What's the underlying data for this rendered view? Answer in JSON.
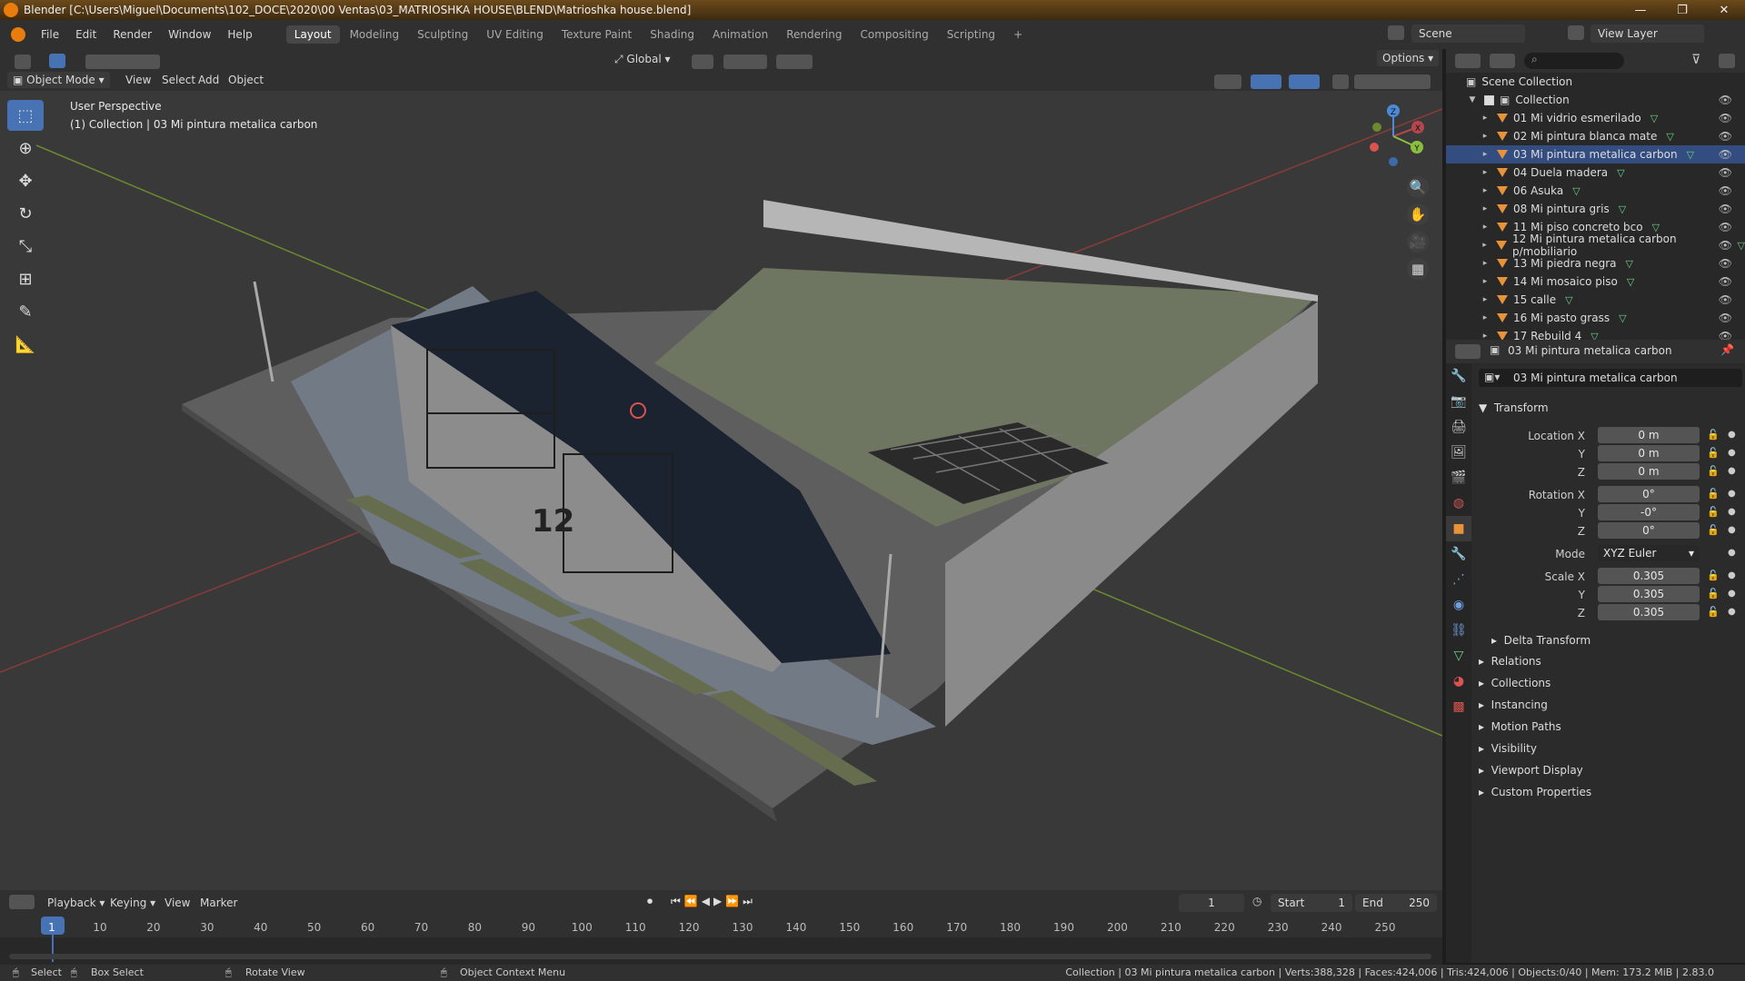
{
  "window": {
    "title": "Blender [C:\\Users\\Miguel\\Documents\\102_DOCE\\2020\\00 Ventas\\03_MATRIOSHKA HOUSE\\BLEND\\Matrioshka house.blend]",
    "controls": [
      "—",
      "❐",
      "✕"
    ]
  },
  "menus": [
    "File",
    "Edit",
    "Render",
    "Window",
    "Help"
  ],
  "workspaces": [
    {
      "label": "Layout",
      "active": true
    },
    {
      "label": "Modeling"
    },
    {
      "label": "Sculpting"
    },
    {
      "label": "UV Editing"
    },
    {
      "label": "Texture Paint"
    },
    {
      "label": "Shading"
    },
    {
      "label": "Animation"
    },
    {
      "label": "Rendering"
    },
    {
      "label": "Compositing"
    },
    {
      "label": "Scripting"
    }
  ],
  "add_workspace": "+",
  "scene": "Scene",
  "view_layer": "View Layer",
  "viewport_header": {
    "mode": "Object Mode",
    "menus": [
      "View",
      "Select",
      "Add",
      "Object"
    ],
    "orientation": "Global",
    "options": "Options"
  },
  "viewport": {
    "perspective": "User Perspective",
    "info": "(1) Collection | 03 Mi pintura metalica carbon",
    "building_number": "12"
  },
  "gizmo": {
    "x": "X",
    "y": "Y",
    "z": "Z"
  },
  "outliner": {
    "root": "Scene Collection",
    "collection": "Collection",
    "items": [
      {
        "label": "01 Mi vidrio esmerilado"
      },
      {
        "label": "02 Mi pintura blanca mate"
      },
      {
        "label": "03 Mi pintura metalica carbon",
        "selected": true
      },
      {
        "label": "04 Duela madera"
      },
      {
        "label": "06 Asuka"
      },
      {
        "label": "08 Mi pintura gris"
      },
      {
        "label": "11 Mi piso concreto bco"
      },
      {
        "label": "12 Mi pintura metalica carbon p/mobiliario"
      },
      {
        "label": "13 Mi piedra negra"
      },
      {
        "label": "14 Mi mosaico piso"
      },
      {
        "label": "15 calle"
      },
      {
        "label": "16 Mi pasto grass"
      },
      {
        "label": "17 Rebuild 4"
      }
    ]
  },
  "properties": {
    "object_name": "03 Mi pintura metalica carbon",
    "datablock": "03 Mi pintura metalica carbon",
    "transform_label": "Transform",
    "location_label": "Location X",
    "rotation_label": "Rotation X",
    "scale_label": "Scale X",
    "y_label": "Y",
    "z_label": "Z",
    "location": [
      "0 m",
      "0 m",
      "0 m"
    ],
    "rotation": [
      "0°",
      "-0°",
      "0°"
    ],
    "mode_label": "Mode",
    "mode": "XYZ Euler",
    "scale": [
      "0.305",
      "0.305",
      "0.305"
    ],
    "delta": "Delta Transform",
    "panels": [
      "Relations",
      "Collections",
      "Instancing",
      "Motion Paths",
      "Visibility",
      "Viewport Display",
      "Custom Properties"
    ]
  },
  "timeline": {
    "menus": [
      "Playback",
      "Keying",
      "View",
      "Marker"
    ],
    "current": "1",
    "start_label": "Start",
    "start": "1",
    "end_label": "End",
    "end": "250",
    "frames": [
      "1",
      "10",
      "20",
      "30",
      "40",
      "50",
      "60",
      "70",
      "80",
      "90",
      "100",
      "110",
      "120",
      "130",
      "140",
      "150",
      "160",
      "170",
      "180",
      "190",
      "200",
      "210",
      "220",
      "230",
      "240",
      "250"
    ]
  },
  "status": {
    "select": "Select",
    "box_select": "Box Select",
    "rotate": "Rotate View",
    "context": "Object Context Menu",
    "stats": "Collection | 03 Mi pintura metalica carbon | Verts:388,328 | Faces:424,006 | Tris:424,006 | Objects:0/40 | Mem: 173.2 MiB | 2.83.0"
  },
  "colors": {
    "accent": "#4772b3",
    "selection": "#334d80",
    "mesh": "#e8933a",
    "title": "#6b4a1b",
    "x_axis": "#b3474d",
    "y_axis": "#8bbf3f",
    "z_axis": "#4c8ad9"
  }
}
